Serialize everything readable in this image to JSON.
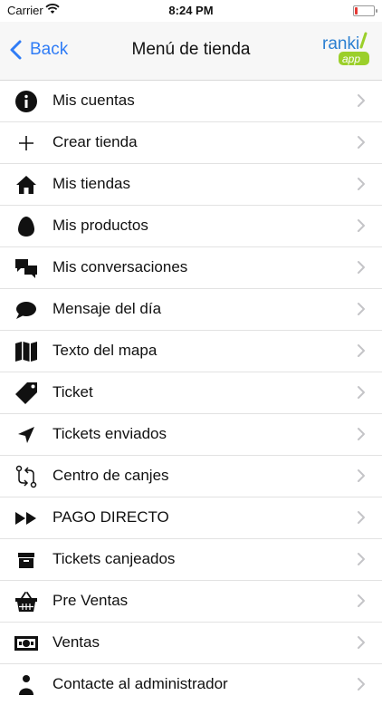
{
  "status_bar": {
    "carrier": "Carrier",
    "time": "8:24 PM"
  },
  "nav": {
    "back_label": "Back",
    "title": "Menú de tienda",
    "logo_text_top": "ranki",
    "logo_text_bottom": "app"
  },
  "menu": [
    {
      "label": "Mis cuentas",
      "icon": "info-icon"
    },
    {
      "label": "Crear tienda",
      "icon": "plus-icon"
    },
    {
      "label": "Mis tiendas",
      "icon": "home-icon"
    },
    {
      "label": "Mis productos",
      "icon": "egg-icon"
    },
    {
      "label": "Mis conversaciones",
      "icon": "chat-bubbles-icon"
    },
    {
      "label": "Mensaje del día",
      "icon": "speech-bubble-icon"
    },
    {
      "label": "Texto del mapa",
      "icon": "map-icon"
    },
    {
      "label": "Ticket",
      "icon": "tag-icon"
    },
    {
      "label": "Tickets enviados",
      "icon": "send-icon"
    },
    {
      "label": "Centro de canjes",
      "icon": "exchange-icon"
    },
    {
      "label": "PAGO DIRECTO",
      "icon": "fast-forward-icon"
    },
    {
      "label": "Tickets canjeados",
      "icon": "archive-box-icon"
    },
    {
      "label": "Pre Ventas",
      "icon": "basket-icon"
    },
    {
      "label": "Ventas",
      "icon": "cash-icon"
    },
    {
      "label": "Contacte al administrador",
      "icon": "person-icon"
    }
  ],
  "colors": {
    "accent": "#2f7cf6",
    "logo_blue": "#2b7fd1",
    "logo_green": "#9bcf2a",
    "separator": "#e2e2e2",
    "chevron": "#c4c4c7"
  }
}
